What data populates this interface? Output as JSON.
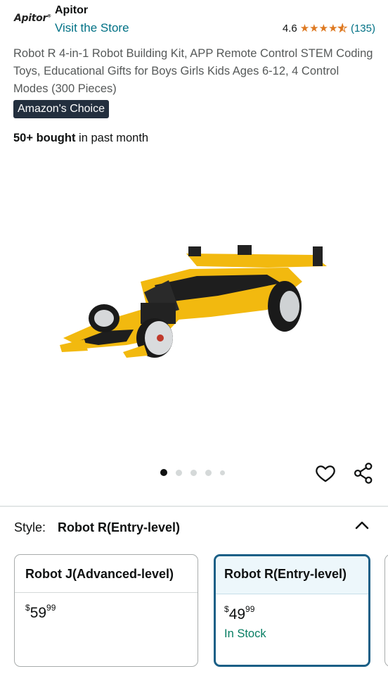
{
  "header": {
    "logo_text": "Apitor",
    "brand": "Apitor",
    "store_link": "Visit the Store",
    "rating_value": "4.6",
    "stars": 4.6,
    "review_count": "(135)"
  },
  "product": {
    "title": "Robot R 4-in-1 Robot Building Kit, APP Remote Control STEM Coding Toys, Educational Gifts for Boys Girls Kids Ages 6-12, 4 Control Modes (300 Pieces)",
    "badge": "Amazon's Choice",
    "bought_bold": "50+ bought",
    "bought_rest": " in past month"
  },
  "gallery": {
    "image_count": 5,
    "active_index": 0
  },
  "style": {
    "label": "Style:",
    "selected": "Robot R(Entry-level)",
    "options": [
      {
        "name": "Robot J(Advanced-level)",
        "price_dollars": "$59",
        "price_cents": "99",
        "stock": ""
      },
      {
        "name": "Robot R(Entry-level)",
        "price_dollars": "$49",
        "price_cents": "99",
        "stock": "In Stock"
      }
    ]
  },
  "colors": {
    "link": "#007185",
    "star": "#de7921",
    "badge_bg": "#232f3e",
    "selected_border": "#1b5f86",
    "in_stock": "#067d62"
  }
}
